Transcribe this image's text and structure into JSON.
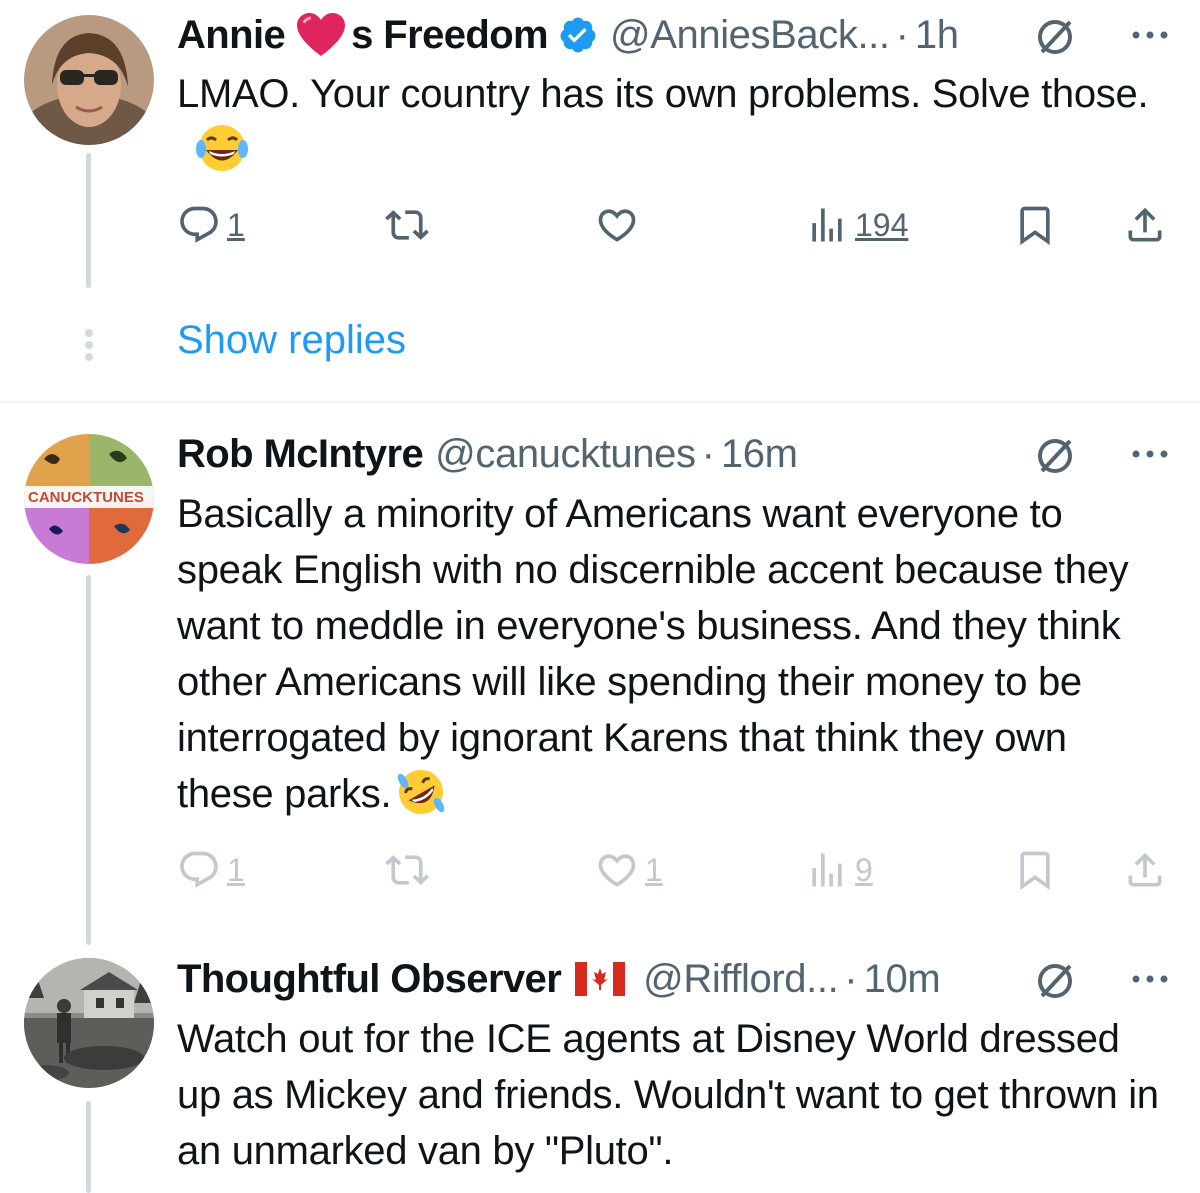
{
  "tweets": [
    {
      "name_part1": "Annie",
      "name_part2": "s Freedom",
      "verified": true,
      "handle": "@AnniesBack...",
      "dot": "·",
      "time": "1h",
      "text": "LMAO.  Your country has its own problems.  Solve those.",
      "reply_count": "1",
      "retweet_count": "",
      "like_count": "",
      "views": "194"
    },
    {
      "name": "Rob McIntyre",
      "handle": "@canucktunes",
      "dot": "·",
      "time": "16m",
      "avatar_text": "CANUCKTUNES",
      "text": "Basically a minority of Americans want everyone to speak English with no discernible accent because they want to meddle in everyone's business. And they think other Americans will like spending their money to be interrogated by ignorant Karens that think they own these parks.",
      "reply_count": "1",
      "retweet_count": "",
      "like_count": "1",
      "views": "9"
    },
    {
      "name": "Thoughtful Observer",
      "handle": "@Rifflord...",
      "dot": "·",
      "time": "10m",
      "text": "Watch out for the ICE agents at Disney World dressed up as Mickey and friends. Wouldn't want to get thrown in an unmarked van by \"Pluto\"."
    }
  ],
  "show_replies": "Show replies",
  "colors": {
    "link": "#1d9bf0",
    "secondary": "#536471",
    "verified": "#1d9bf0",
    "heart": "#e0245e",
    "line": "#cfd9de"
  }
}
